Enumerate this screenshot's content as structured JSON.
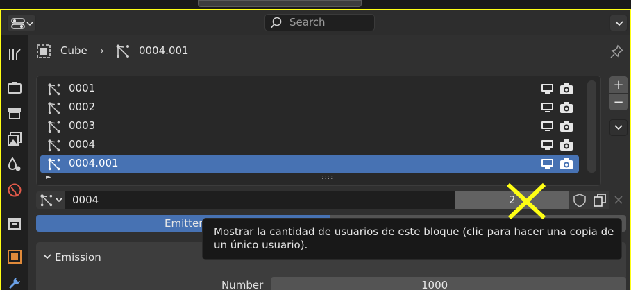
{
  "header": {
    "search_placeholder": "Search"
  },
  "breadcrumb": {
    "object_name": "Cube",
    "separator": "›",
    "particle_system_name": "0004.001"
  },
  "particle_list": {
    "items": [
      {
        "label": "0001",
        "selected": false
      },
      {
        "label": "0002",
        "selected": false
      },
      {
        "label": "0003",
        "selected": false
      },
      {
        "label": "0004",
        "selected": false
      },
      {
        "label": "0004.001",
        "selected": true
      }
    ],
    "expander_glyph": "►",
    "grip_glyph": "::::"
  },
  "side_buttons": {
    "add": "+",
    "remove": "−"
  },
  "id_block": {
    "name": "0004",
    "users": "2"
  },
  "particle_type": {
    "selected": "Emitter"
  },
  "emission_panel": {
    "title": "Emission",
    "number_label": "Number",
    "number_value": "1000"
  },
  "tooltip": {
    "text": "Mostrar la cantidad de usuarios de este bloque (clic para hacer una copia de un único usuario)."
  },
  "colors": {
    "accent": "#4772b3",
    "active_frame": "#ffff14",
    "annotation": "#ffff14"
  }
}
